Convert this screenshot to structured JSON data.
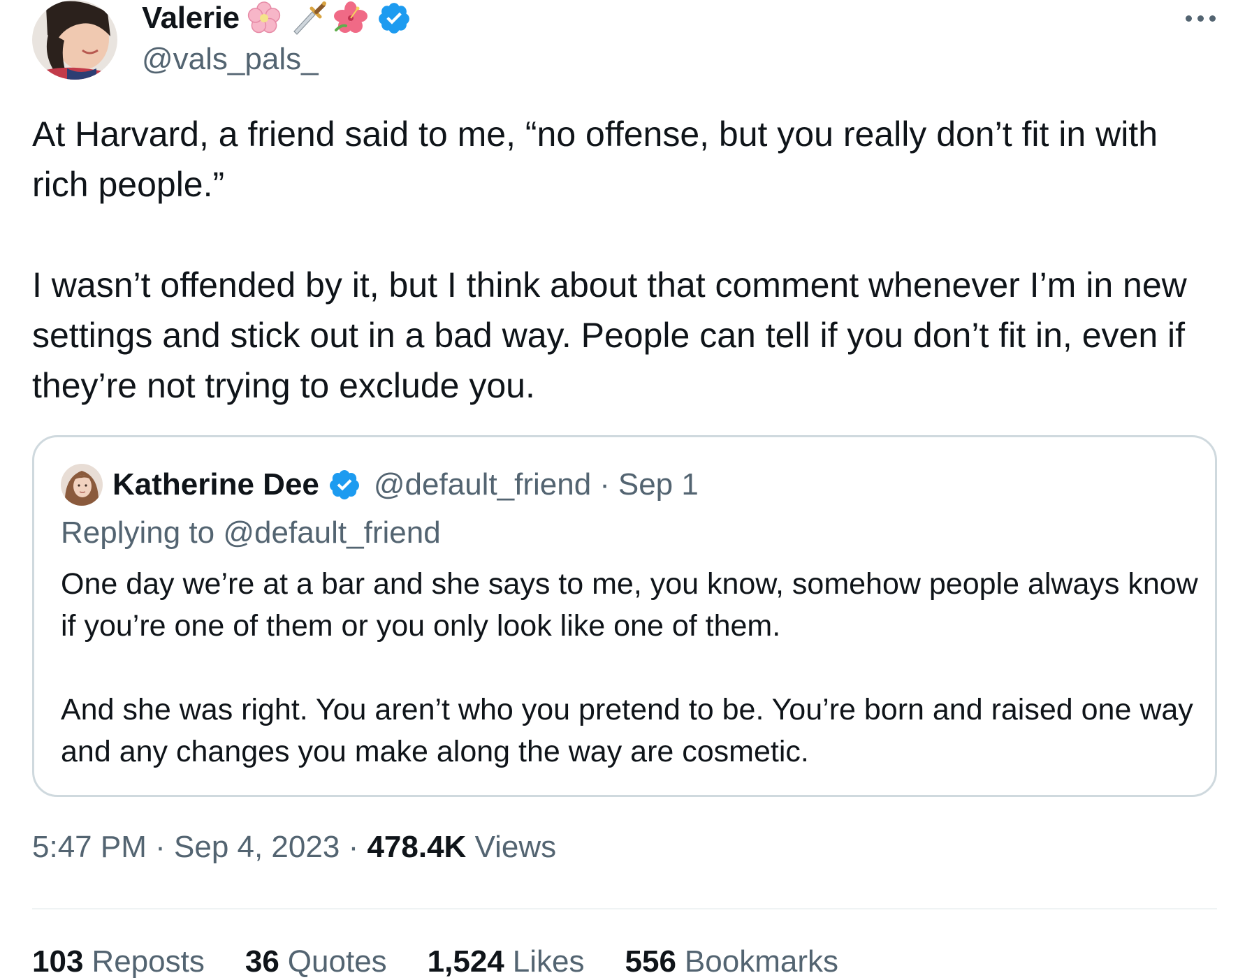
{
  "author": {
    "display_name": "Valerie",
    "handle": "@vals_pals_",
    "emojis": [
      "cherry-blossom-icon",
      "dagger-icon",
      "hibiscus-icon"
    ],
    "verified": true
  },
  "tweet": {
    "paragraphs": [
      "At Harvard, a friend said to me, “no offense, but you really don’t fit in with rich people.”",
      "I wasn’t offended by it, but I think about that comment whenever I’m in new settings and stick out in a bad way. People can tell if you don’t fit in, even if they’re not trying to exclude you."
    ],
    "time": "5:47 PM",
    "date": "Sep 4, 2023",
    "separator": "·",
    "views_count": "478.4K",
    "views_label": "Views"
  },
  "quote": {
    "display_name": "Katherine Dee",
    "handle": "@default_friend",
    "separator": "·",
    "date": "Sep 1",
    "verified": true,
    "replying_label": "Replying to",
    "replying_handle": "@default_friend",
    "paragraphs": [
      "One day we’re at a bar and she says to me, you know, somehow people always know if you’re one of them or you only look like one of them.",
      "And she was right. You aren’t who you pretend to be. You’re born and raised one way and any changes you make along the way are cosmetic."
    ]
  },
  "stats": {
    "reposts_count": "103",
    "reposts_label": "Reposts",
    "quotes_count": "36",
    "quotes_label": "Quotes",
    "likes_count": "1,524",
    "likes_label": "Likes",
    "bookmarks_count": "556",
    "bookmarks_label": "Bookmarks"
  },
  "colors": {
    "text_primary": "#0f1419",
    "text_secondary": "#536471",
    "verified_blue": "#1d9bf0",
    "border": "#cfd9de"
  }
}
